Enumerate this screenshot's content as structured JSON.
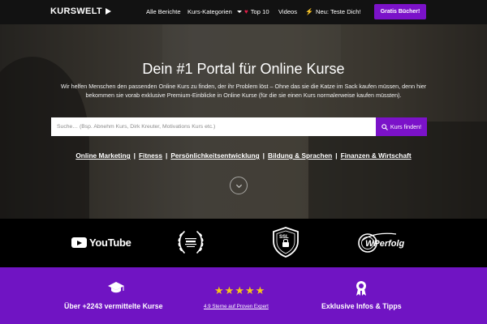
{
  "nav": {
    "logo": "KURSWELT",
    "items": [
      {
        "label": "Alle Berichte"
      },
      {
        "label": "Kurs-Kategorien"
      },
      {
        "label": "Top 10"
      },
      {
        "label": "Videos"
      },
      {
        "label": "Neu: Teste Dich!"
      }
    ],
    "cta": "Gratis Bücher!"
  },
  "hero": {
    "title": "Dein #1 Portal für Online Kurse",
    "subtitle": "Wir helfen Menschen den passenden Online Kurs zu finden, der ihr Problem löst – Ohne das sie die Katze im Sack kaufen müssen, denn hier bekommen sie vorab exklusive Premium-Einblicke in Online Kurse (für die sie einen Kurs normalerweise kaufen müssten).",
    "search_placeholder": "Suche… (Bsp. Abnehm Kurs, Dirk Kreuter, Motivations Kurs etc.)",
    "search_button": "Kurs finden!",
    "categories": [
      "Online Marketing",
      "Fitness",
      "Persönlichkeitsentwicklung",
      "Bildung & Sprachen",
      "Finanzen & Wirtschaft"
    ]
  },
  "logos": {
    "youtube": "YouTube",
    "ssl": "SSL",
    "wperfolg": "WPerfolg"
  },
  "stats": {
    "courses": "Über +2243 vermittelte Kurse",
    "rating_link": "4.9 Sterne auf Proven Expert",
    "rating": 4.9,
    "exclusive": "Exklusive Infos & Tipps"
  },
  "colors": {
    "accent": "#7b12c9",
    "stats_bg": "#7014c3",
    "star": "#f5c518",
    "heart": "#e11d48"
  }
}
